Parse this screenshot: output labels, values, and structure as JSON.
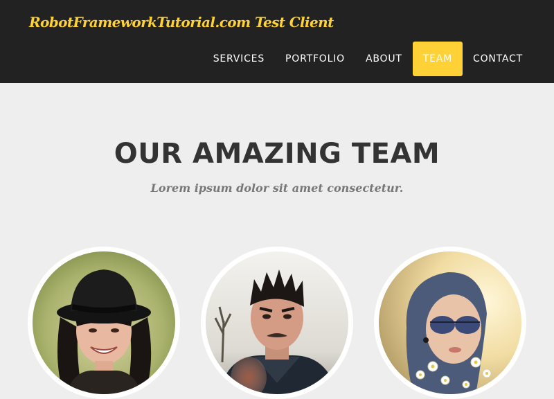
{
  "navbar": {
    "brand": "RobotFrameworkTutorial.com Test Client",
    "items": [
      {
        "label": "SERVICES",
        "active": false
      },
      {
        "label": "PORTFOLIO",
        "active": false
      },
      {
        "label": "ABOUT",
        "active": false
      },
      {
        "label": "TEAM",
        "active": true
      },
      {
        "label": "CONTACT",
        "active": false
      }
    ]
  },
  "team": {
    "heading": "OUR AMAZING TEAM",
    "subheading": "Lorem ipsum dolor sit amet consectetur."
  },
  "colors": {
    "accent": "#fed136",
    "navbar_bg": "#222222",
    "page_bg": "#eeeeee",
    "heading": "#333333",
    "muted": "#777777"
  }
}
